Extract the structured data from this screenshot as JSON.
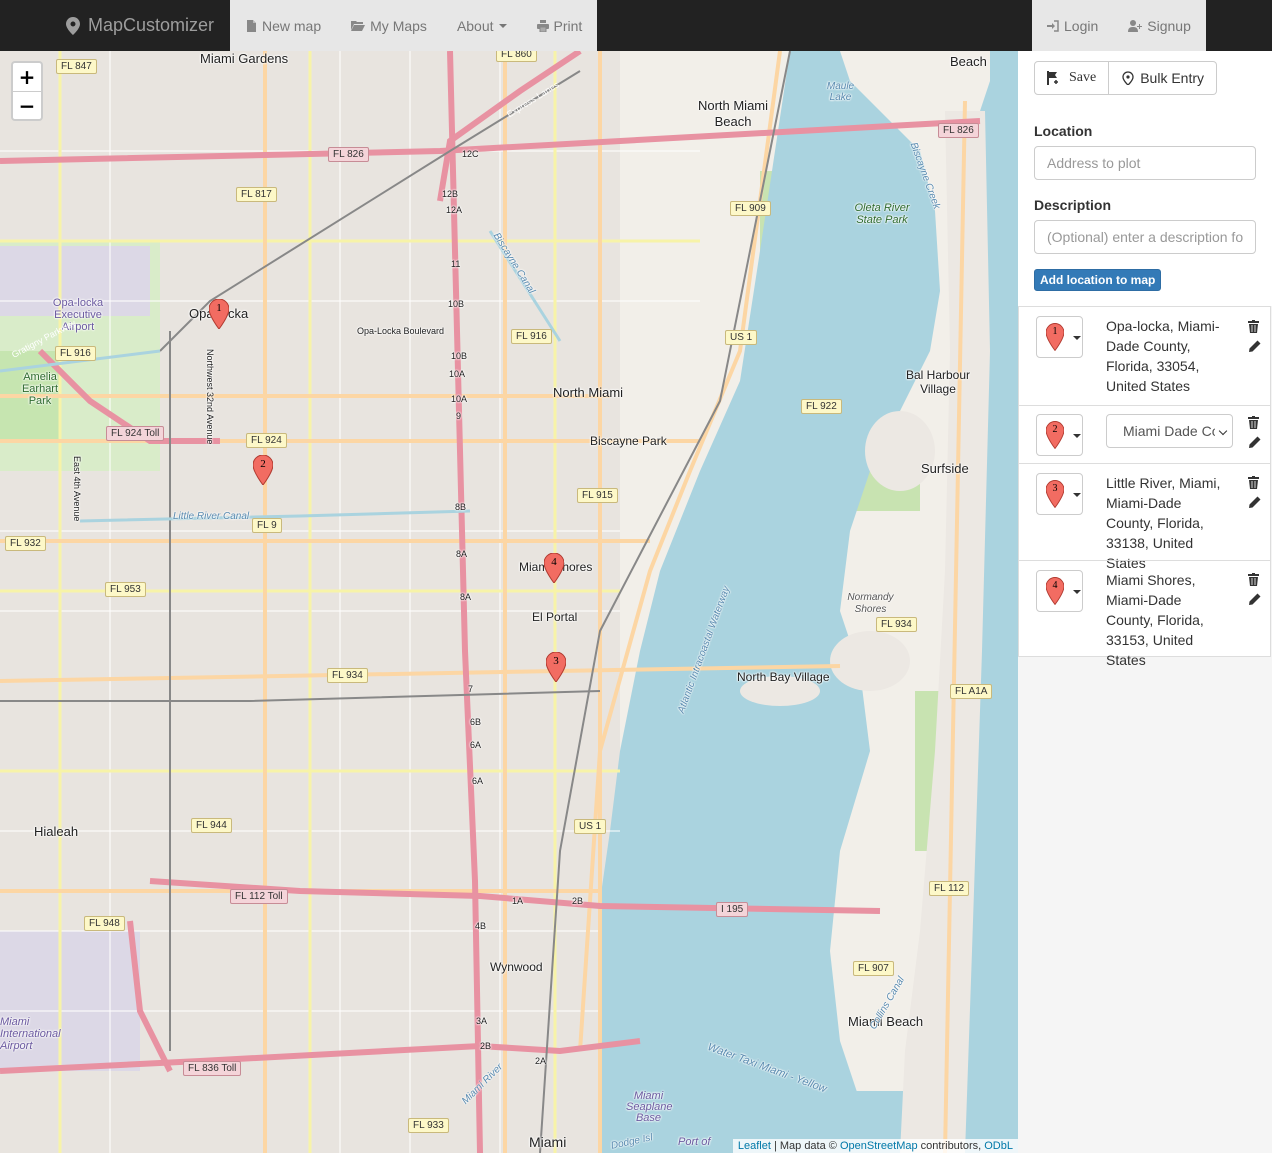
{
  "navbar": {
    "brand": "MapCustomizer",
    "links": {
      "new_map": "New map",
      "my_maps": "My Maps",
      "about": "About",
      "print": "Print",
      "login": "Login",
      "signup": "Signup"
    }
  },
  "map": {
    "zoom_in": "+",
    "zoom_out": "−",
    "place_labels": {
      "miami_gardens": "Miami Gardens",
      "north_miami_beach": "North Miami Beach",
      "opa_locka": "Opa-locka",
      "opa_locka_airport": "Opa-locka Executive Airport",
      "amelia_earhart_park": "Amelia Earhart Park",
      "north_miami": "North Miami",
      "biscayne_park": "Biscayne Park",
      "miami_shores": "Miami Shores",
      "el_portal": "El Portal",
      "north_bay_village": "North Bay Village",
      "bal_harbour": "Bal Harbour Village",
      "surfside": "Surfside",
      "normandy_shores": "Normandy Shores",
      "hialeah": "Hialeah",
      "wynwood": "Wynwood",
      "miami_beach": "Miami Beach",
      "miami": "Miami",
      "beach": "Beach",
      "oleta_river": "Oleta River State Park",
      "maule_lake": "Maule Lake",
      "miami_intl_airport": "Miami International Airport",
      "miami_seaplane": "Miami Seaplane Base",
      "port_of": "Port of"
    },
    "road_labels": {
      "fl847": "FL 847",
      "fl860": "FL 860",
      "fl826a": "FL 826",
      "fl826b": "FL 826",
      "fl817": "FL 817",
      "fl909": "FL 909",
      "fl916a": "FL 916",
      "fl916b": "FL 916",
      "fl924toll": "FL 924 Toll",
      "fl924": "FL 924",
      "fl9": "FL 9",
      "fl932": "FL 932",
      "fl953": "FL 953",
      "fl915": "FL 915",
      "fl922": "FL 922",
      "us1a": "US 1",
      "us1b": "US 1",
      "fl934a": "FL 934",
      "fl934b": "FL 934",
      "fla1a": "FL A1A",
      "fl944": "FL 944",
      "fl112toll": "FL 112 Toll",
      "fl112": "FL 112",
      "fl948": "FL 948",
      "i195": "I 195",
      "fl907": "FL 907",
      "fl836toll": "FL 836 Toll",
      "fl933": "FL 933",
      "opa_locka_blvd": "Opa-Locka Boulevard",
      "nw_32nd_ave": "Northwest 32nd Avenue",
      "east_4th_ave": "East 4th Avenue",
      "gratigny_pkwy": "Gratigny Parkway",
      "little_river_canal": "Little River Canal",
      "biscayne_canal": "Biscayne Canal",
      "atlantic_waterway": "Atlantic Intracoastal Waterway",
      "water_taxi": "Water Taxi Miami - Yellow",
      "collins_canal": "Collins Canal",
      "biscayne_creek": "Biscayne Creek",
      "express_lanes": "Express Lanes",
      "miami_river": "Miami River",
      "dodge_island": "Dodge Isl"
    },
    "exit_labels": [
      "12C",
      "12B",
      "12A",
      "11",
      "10B",
      "10B",
      "10A",
      "10A",
      "9",
      "8B",
      "8A",
      "8A",
      "7",
      "6B",
      "6A",
      "6A",
      "4B",
      "3A",
      "2B",
      "2A",
      "2B",
      "1A"
    ],
    "markers": [
      {
        "num": "1"
      },
      {
        "num": "2"
      },
      {
        "num": "4"
      },
      {
        "num": "3"
      }
    ],
    "attribution": {
      "leaflet": "Leaflet",
      "sep1": " | Map data © ",
      "osm": "OpenStreetMap",
      "contributors": " contributors, ",
      "odbl": "ODbL"
    }
  },
  "sidebar": {
    "save_label": "Save",
    "bulk_label": "Bulk Entry",
    "location_label": "Location",
    "location_placeholder": "Address to plot",
    "description_label": "Description",
    "description_placeholder": "(Optional) enter a description for this location",
    "add_button": "Add location to map",
    "locations": [
      {
        "num": "1",
        "text": "Opa-locka, Miami-Dade County, Florida, 33054, United States"
      },
      {
        "num": "2",
        "select_value": "Miami Dade College"
      },
      {
        "num": "3",
        "text": "Little River, Miami, Miami-Dade County, Florida, 33138, United States"
      },
      {
        "num": "4",
        "text": "Miami Shores, Miami-Dade County, Florida, 33153, United States"
      }
    ]
  },
  "colors": {
    "navbar_bg": "#222222",
    "nav_active_bg": "#e7e7e7",
    "primary_button": "#337ab7",
    "marker_fill": "#f26c62",
    "water": "#aad3df",
    "land": "#f2efe9",
    "motorway": "#e892a2",
    "primary_road": "#fcd6a4"
  }
}
